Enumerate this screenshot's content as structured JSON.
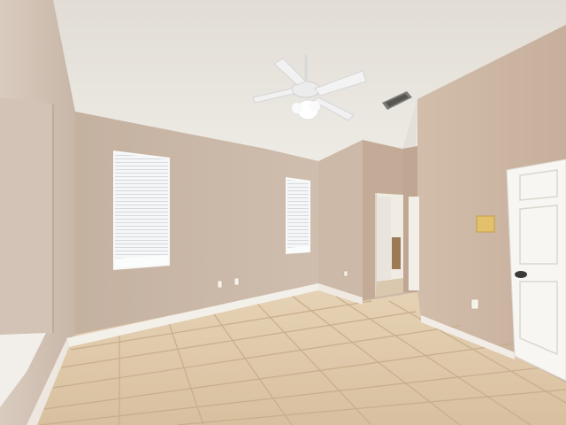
{
  "scene": {
    "subject": "empty-room-interior",
    "colors": {
      "ceiling": "#e9e6e0",
      "wall_back": "#c9b7a7",
      "wall_left": "#d3c4b6",
      "wall_right": "#cdb8a6",
      "floor_tile": "#ddc6a6",
      "grout": "#c4ab8a",
      "baseboard": "#f3efe9",
      "window_light": "#f5f7f8",
      "door": "#f7f6f3",
      "thermostat": "#e3c06b"
    }
  }
}
